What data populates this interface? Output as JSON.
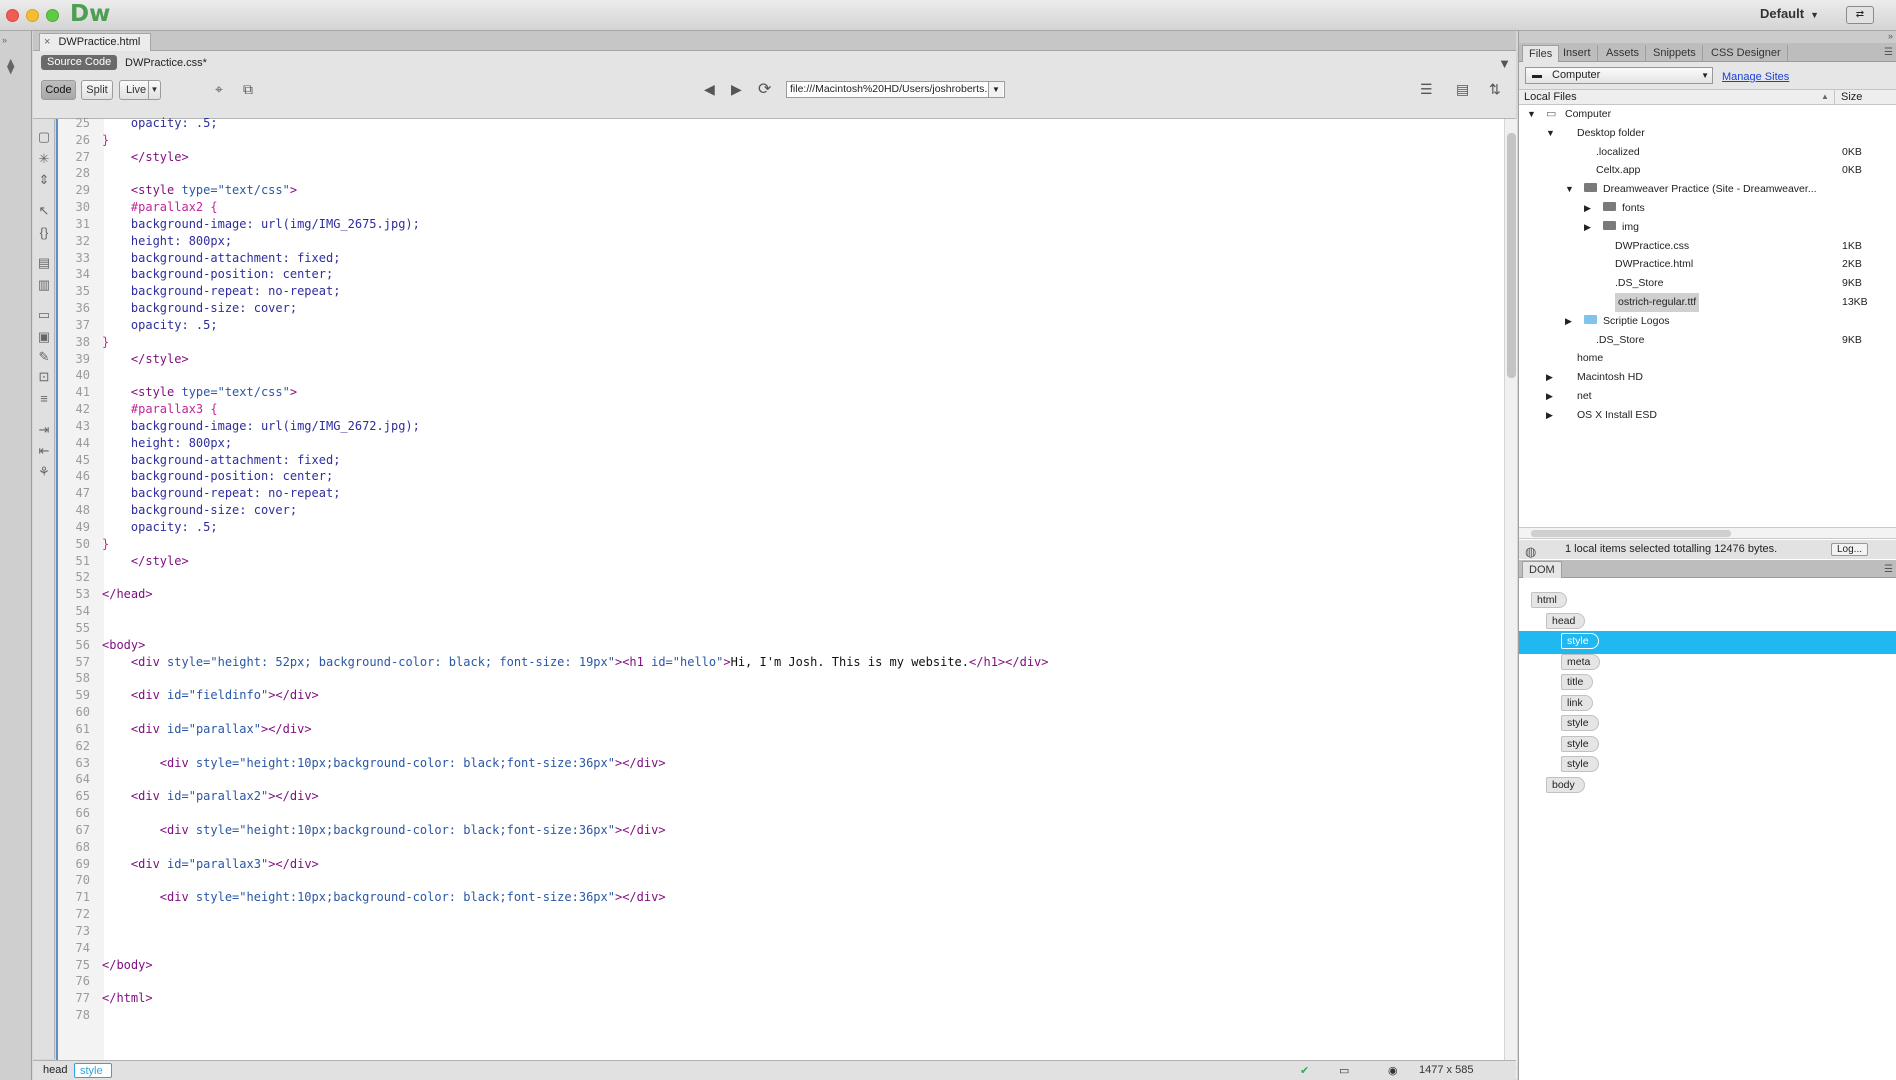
{
  "app": {
    "logo": "Dw",
    "workspace": "Default"
  },
  "document": {
    "tab": "DWPractice.html",
    "source_code_label": "Source Code",
    "related_file": "DWPractice.css*",
    "toolbar": {
      "code": "Code",
      "split": "Split",
      "live": "Live",
      "url": "file:///Macintosh%20HD/Users/joshroberts..."
    }
  },
  "code": [
    {
      "n": "25",
      "segs": [
        [
          "    opacity: .5;",
          "t-prop"
        ]
      ]
    },
    {
      "n": "26",
      "segs": [
        [
          "}",
          "t-sel"
        ]
      ]
    },
    {
      "n": "27",
      "segs": [
        [
          "    ",
          ""
        ],
        [
          "</style>",
          "t-tag"
        ]
      ]
    },
    {
      "n": "28",
      "segs": []
    },
    {
      "n": "29",
      "segs": [
        [
          "    ",
          ""
        ],
        [
          "<style ",
          "t-tag"
        ],
        [
          "type=",
          "t-attr"
        ],
        [
          "\"text/css\"",
          "t-val"
        ],
        [
          ">",
          "t-tag"
        ]
      ]
    },
    {
      "n": "30",
      "segs": [
        [
          "    ",
          ""
        ],
        [
          "#parallax2 {",
          "t-sel"
        ]
      ]
    },
    {
      "n": "31",
      "segs": [
        [
          "    background-image: url(img/IMG_2675.jpg);",
          "t-prop"
        ]
      ]
    },
    {
      "n": "32",
      "segs": [
        [
          "    height: 800px;",
          "t-prop"
        ]
      ]
    },
    {
      "n": "33",
      "segs": [
        [
          "    background-attachment: fixed;",
          "t-prop"
        ]
      ]
    },
    {
      "n": "34",
      "segs": [
        [
          "    background-position: center;",
          "t-prop"
        ]
      ]
    },
    {
      "n": "35",
      "segs": [
        [
          "    background-repeat: no-repeat;",
          "t-prop"
        ]
      ]
    },
    {
      "n": "36",
      "segs": [
        [
          "    background-size: cover;",
          "t-prop"
        ]
      ]
    },
    {
      "n": "37",
      "segs": [
        [
          "    opacity: .5;",
          "t-prop"
        ]
      ]
    },
    {
      "n": "38",
      "segs": [
        [
          "}",
          "t-sel"
        ]
      ]
    },
    {
      "n": "39",
      "segs": [
        [
          "    ",
          ""
        ],
        [
          "</style>",
          "t-tag"
        ]
      ]
    },
    {
      "n": "40",
      "segs": []
    },
    {
      "n": "41",
      "segs": [
        [
          "    ",
          ""
        ],
        [
          "<style ",
          "t-tag"
        ],
        [
          "type=",
          "t-attr"
        ],
        [
          "\"text/css\"",
          "t-val"
        ],
        [
          ">",
          "t-tag"
        ]
      ]
    },
    {
      "n": "42",
      "segs": [
        [
          "    ",
          ""
        ],
        [
          "#parallax3 {",
          "t-sel"
        ]
      ]
    },
    {
      "n": "43",
      "segs": [
        [
          "    background-image: url(img/IMG_2672.jpg);",
          "t-prop"
        ]
      ]
    },
    {
      "n": "44",
      "segs": [
        [
          "    height: 800px;",
          "t-prop"
        ]
      ]
    },
    {
      "n": "45",
      "segs": [
        [
          "    background-attachment: fixed;",
          "t-prop"
        ]
      ]
    },
    {
      "n": "46",
      "segs": [
        [
          "    background-position: center;",
          "t-prop"
        ]
      ]
    },
    {
      "n": "47",
      "segs": [
        [
          "    background-repeat: no-repeat;",
          "t-prop"
        ]
      ]
    },
    {
      "n": "48",
      "segs": [
        [
          "    background-size: cover;",
          "t-prop"
        ]
      ]
    },
    {
      "n": "49",
      "segs": [
        [
          "    opacity: .5;",
          "t-prop"
        ]
      ]
    },
    {
      "n": "50",
      "segs": [
        [
          "}",
          "t-sel"
        ]
      ]
    },
    {
      "n": "51",
      "segs": [
        [
          "    ",
          ""
        ],
        [
          "</style>",
          "t-tag"
        ]
      ]
    },
    {
      "n": "52",
      "segs": []
    },
    {
      "n": "53",
      "segs": [
        [
          "</head>",
          "t-tag"
        ]
      ]
    },
    {
      "n": "54",
      "segs": []
    },
    {
      "n": "55",
      "segs": []
    },
    {
      "n": "56",
      "segs": [
        [
          "<body>",
          "t-tag"
        ]
      ]
    },
    {
      "n": "57",
      "segs": [
        [
          "    ",
          ""
        ],
        [
          "<div ",
          "t-tag"
        ],
        [
          "style=",
          "t-attr"
        ],
        [
          "\"height: 52px; background-color: black; font-size: 19px\"",
          "t-val"
        ],
        [
          "><h1 ",
          "t-tag"
        ],
        [
          "id=",
          "t-attr"
        ],
        [
          "\"hello\"",
          "t-val"
        ],
        [
          ">",
          "t-tag"
        ],
        [
          "Hi, I'm Josh. This is my website.",
          "t-txt"
        ],
        [
          "</h1></div>",
          "t-tag"
        ]
      ]
    },
    {
      "n": "58",
      "segs": []
    },
    {
      "n": "59",
      "segs": [
        [
          "    ",
          ""
        ],
        [
          "<div ",
          "t-tag"
        ],
        [
          "id=",
          "t-attr"
        ],
        [
          "\"fieldinfo\"",
          "t-val"
        ],
        [
          "></div>",
          "t-tag"
        ]
      ]
    },
    {
      "n": "60",
      "segs": []
    },
    {
      "n": "61",
      "segs": [
        [
          "    ",
          ""
        ],
        [
          "<div ",
          "t-tag"
        ],
        [
          "id=",
          "t-attr"
        ],
        [
          "\"parallax\"",
          "t-val"
        ],
        [
          "></div>",
          "t-tag"
        ]
      ]
    },
    {
      "n": "62",
      "segs": []
    },
    {
      "n": "63",
      "segs": [
        [
          "        ",
          ""
        ],
        [
          "<div ",
          "t-tag"
        ],
        [
          "style=",
          "t-attr"
        ],
        [
          "\"height:10px;background-color: black;font-size:36px\"",
          "t-val"
        ],
        [
          "></div>",
          "t-tag"
        ]
      ]
    },
    {
      "n": "64",
      "segs": []
    },
    {
      "n": "65",
      "segs": [
        [
          "    ",
          ""
        ],
        [
          "<div ",
          "t-tag"
        ],
        [
          "id=",
          "t-attr"
        ],
        [
          "\"parallax2\"",
          "t-val"
        ],
        [
          "></div>",
          "t-tag"
        ]
      ]
    },
    {
      "n": "66",
      "segs": []
    },
    {
      "n": "67",
      "segs": [
        [
          "        ",
          ""
        ],
        [
          "<div ",
          "t-tag"
        ],
        [
          "style=",
          "t-attr"
        ],
        [
          "\"height:10px;background-color: black;font-size:36px\"",
          "t-val"
        ],
        [
          "></div>",
          "t-tag"
        ]
      ]
    },
    {
      "n": "68",
      "segs": []
    },
    {
      "n": "69",
      "segs": [
        [
          "    ",
          ""
        ],
        [
          "<div ",
          "t-tag"
        ],
        [
          "id=",
          "t-attr"
        ],
        [
          "\"parallax3\"",
          "t-val"
        ],
        [
          "></div>",
          "t-tag"
        ]
      ]
    },
    {
      "n": "70",
      "segs": []
    },
    {
      "n": "71",
      "segs": [
        [
          "        ",
          ""
        ],
        [
          "<div ",
          "t-tag"
        ],
        [
          "style=",
          "t-attr"
        ],
        [
          "\"height:10px;background-color: black;font-size:36px\"",
          "t-val"
        ],
        [
          "></div>",
          "t-tag"
        ]
      ]
    },
    {
      "n": "72",
      "segs": []
    },
    {
      "n": "73",
      "segs": []
    },
    {
      "n": "74",
      "segs": []
    },
    {
      "n": "75",
      "segs": [
        [
          "</body>",
          "t-tag"
        ]
      ]
    },
    {
      "n": "76",
      "segs": []
    },
    {
      "n": "77",
      "segs": [
        [
          "</html>",
          "t-tag"
        ]
      ]
    },
    {
      "n": "78",
      "segs": []
    }
  ],
  "status": {
    "crumbs": [
      "head",
      "style"
    ],
    "dimensions": "1477 x 585"
  },
  "panels": {
    "tabs": [
      "Files",
      "Insert",
      "Assets",
      "Snippets",
      "CSS Designer"
    ],
    "site": "Computer",
    "manage_sites": "Manage Sites",
    "col_local": "Local Files",
    "col_size": "Size",
    "tree": [
      {
        "lvl": 0,
        "tw": "open",
        "icon": "computer",
        "name": "Computer",
        "size": ""
      },
      {
        "lvl": 1,
        "tw": "open",
        "icon": "",
        "name": "Desktop folder",
        "size": ""
      },
      {
        "lvl": 2,
        "tw": "",
        "icon": "",
        "name": ".localized",
        "size": "0KB"
      },
      {
        "lvl": 2,
        "tw": "",
        "icon": "",
        "name": "Celtx.app",
        "size": "0KB"
      },
      {
        "lvl": 2,
        "tw": "open",
        "icon": "folder",
        "name": "Dreamweaver Practice (Site - Dreamweaver...",
        "size": ""
      },
      {
        "lvl": 3,
        "tw": "closed",
        "icon": "folder",
        "name": "fonts",
        "size": ""
      },
      {
        "lvl": 3,
        "tw": "closed",
        "icon": "folder",
        "name": "img",
        "size": ""
      },
      {
        "lvl": 3,
        "tw": "",
        "icon": "",
        "name": "DWPractice.css",
        "size": "1KB"
      },
      {
        "lvl": 3,
        "tw": "",
        "icon": "",
        "name": "DWPractice.html",
        "size": "2KB"
      },
      {
        "lvl": 3,
        "tw": "",
        "icon": "",
        "name": ".DS_Store",
        "size": "9KB"
      },
      {
        "lvl": 3,
        "tw": "",
        "icon": "",
        "name": "ostrich-regular.ttf",
        "size": "13KB",
        "selected": true
      },
      {
        "lvl": 2,
        "tw": "closed",
        "icon": "folder-blue",
        "name": "Scriptie Logos",
        "size": ""
      },
      {
        "lvl": 2,
        "tw": "",
        "icon": "",
        "name": ".DS_Store",
        "size": "9KB"
      },
      {
        "lvl": 1,
        "tw": "",
        "icon": "",
        "name": "home",
        "size": ""
      },
      {
        "lvl": 1,
        "tw": "closed",
        "icon": "",
        "name": "Macintosh HD",
        "size": ""
      },
      {
        "lvl": 1,
        "tw": "closed",
        "icon": "",
        "name": "net",
        "size": ""
      },
      {
        "lvl": 1,
        "tw": "closed",
        "icon": "",
        "name": "OS X Install ESD",
        "size": ""
      }
    ],
    "status_msg": "1 local items selected totalling 12476 bytes.",
    "log": "Log...",
    "dom_tab": "DOM",
    "dom": [
      {
        "name": "html",
        "lvl": 0
      },
      {
        "name": "head",
        "lvl": 1
      },
      {
        "name": "style",
        "lvl": 2,
        "selected": true
      },
      {
        "name": "meta",
        "lvl": 2
      },
      {
        "name": "title",
        "lvl": 2
      },
      {
        "name": "link",
        "lvl": 2
      },
      {
        "name": "style",
        "lvl": 2
      },
      {
        "name": "style",
        "lvl": 2
      },
      {
        "name": "style",
        "lvl": 2
      },
      {
        "name": "body",
        "lvl": 1
      }
    ]
  },
  "colors": {
    "accent": "#1fb8f0",
    "link": "#1a3fd6"
  }
}
